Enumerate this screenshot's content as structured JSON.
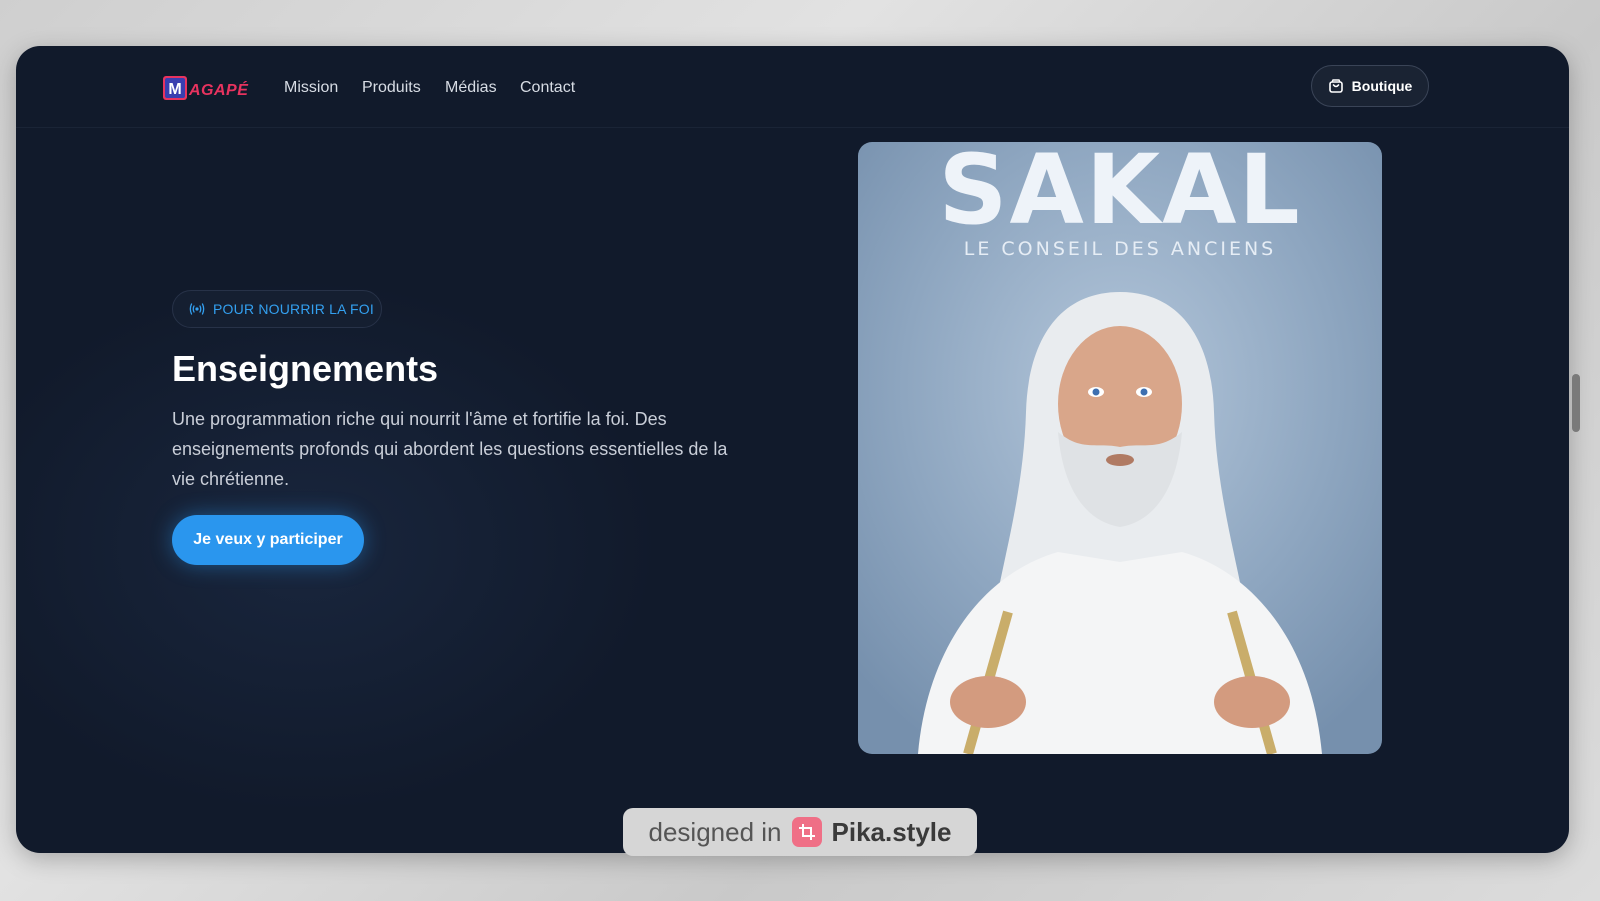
{
  "header": {
    "logo_text": "MAGAPÉ",
    "nav": [
      {
        "label": "Mission"
      },
      {
        "label": "Produits"
      },
      {
        "label": "Médias"
      },
      {
        "label": "Contact"
      }
    ],
    "shop_button_label": "Boutique",
    "shop_icon": "shopping-bag-icon"
  },
  "hero": {
    "badge_icon": "broadcast-icon",
    "badge_text": "POUR NOURRIR LA FOI",
    "title": "Enseignements",
    "description": "Une programmation riche qui nourrit l'âme et fortifie la foi. Des enseignements profonds qui abordent les questions essentielles de la vie chrétienne.",
    "cta_label": "Je veux y participer"
  },
  "poster": {
    "title": "SAKAL",
    "subtitle": "LE CONSEIL DES ANCIENS"
  },
  "watermark": {
    "prefix": "designed in",
    "brand": "Pika.style",
    "icon": "crop-icon"
  },
  "colors": {
    "background": "#111a2b",
    "accent": "#2a96ee",
    "badge_text": "#33a0f0",
    "logo_pink": "#e8335f"
  }
}
